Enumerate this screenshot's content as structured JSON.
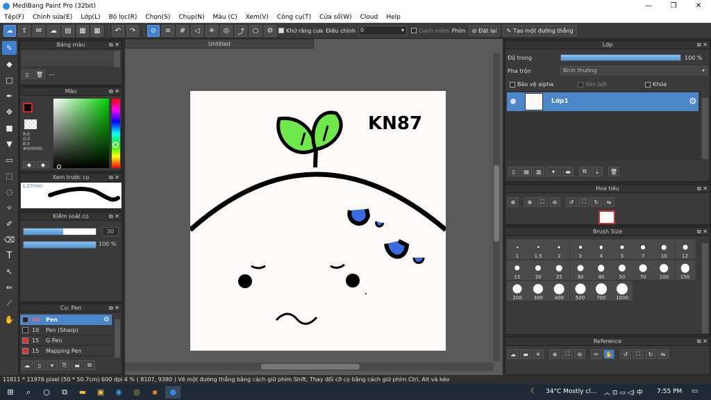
{
  "window": {
    "title": "MediBang Paint Pro (32bit)",
    "min": "—",
    "max": "❐",
    "close": "✕"
  },
  "menu": [
    "Tệp(F)",
    "Chỉnh sửa(E)",
    "Lớp(L)",
    "Bộ lọc(R)",
    "Chọn(S)",
    "Chụp(N)",
    "Màu (C)",
    "Xem(V)",
    "Công cụ(T)",
    "Cửa sổ(W)",
    "Cloud",
    "Help"
  ],
  "toolbar": {
    "antialias": "Khử răng cưa",
    "adjust_label": "Điều chỉnh",
    "adjust_value": "0",
    "snap_label": "Canh mềm",
    "key_label": "Phím",
    "reset_label": "Đặt lại",
    "line_label": "Tạo một đường thẳng"
  },
  "panels": {
    "palette": {
      "title": "Bảng màu",
      "sep": "---"
    },
    "color": {
      "title": "Màu",
      "r": "R:0",
      "g": "G:0",
      "b": "B:0",
      "hex": "#000000"
    },
    "brush_preview": {
      "title": "Xem trước cọ",
      "size": "1.27mm"
    },
    "brush_control": {
      "title": "Kiểm soát cọ",
      "size": "30",
      "opacity": "100 %",
      "size_fill": 0.55,
      "opacity_fill": 1.0
    },
    "brush_list": {
      "title": "Cọ: Pen",
      "items": [
        {
          "size": "30",
          "name": "Pen",
          "color": "#1e2733",
          "selected": true
        },
        {
          "size": "10",
          "name": "Pen (Sharp)",
          "color": "#1e2733",
          "selected": false
        },
        {
          "size": "15",
          "name": "G Pen",
          "color": "#e53030",
          "selected": false
        },
        {
          "size": "15",
          "name": "Mapping Pen",
          "color": "#e53030",
          "selected": false
        }
      ]
    },
    "layer": {
      "title": "Lớp",
      "opacity_label": "Độ trong",
      "opacity_value": "100 %",
      "blend_label": "Pha trộn",
      "blend_value": "Bình thường",
      "protect_alpha": "Bảo vệ alpha",
      "clipping": "Xén bớt",
      "lock": "Khóa",
      "layer_name": "Lớp1"
    },
    "navigator": {
      "title": "Hoa tiêu"
    },
    "brush_size": {
      "title": "Brush Size",
      "sizes": [
        "1",
        "1.5",
        "2",
        "3",
        "4",
        "5",
        "7",
        "10",
        "12",
        "15",
        "20",
        "25",
        "30",
        "40",
        "50",
        "70",
        "100",
        "150",
        "200",
        "300",
        "400",
        "500",
        "700",
        "1000"
      ]
    },
    "reference": {
      "title": "Reference"
    }
  },
  "document": {
    "tab": "Untitled",
    "text": "KN87"
  },
  "status": "11811 * 11976 pixel  (50 * 50.7cm)  600 dpi  4 %  ( 8107, 9380 )  Vẽ một đường thẳng bằng cách giữ phím Shift, Thay đổi cỡ cọ bằng cách giữ phím Ctrl, Alt và kéo",
  "taskbar": {
    "weather": "34°C  Mostly cl...",
    "time": "7:55 PM"
  },
  "colors": {
    "accent": "#3d7fd1",
    "selected_row": "#4a86c8",
    "leaf": "#6ee84a",
    "blue": "#3a6be0"
  }
}
